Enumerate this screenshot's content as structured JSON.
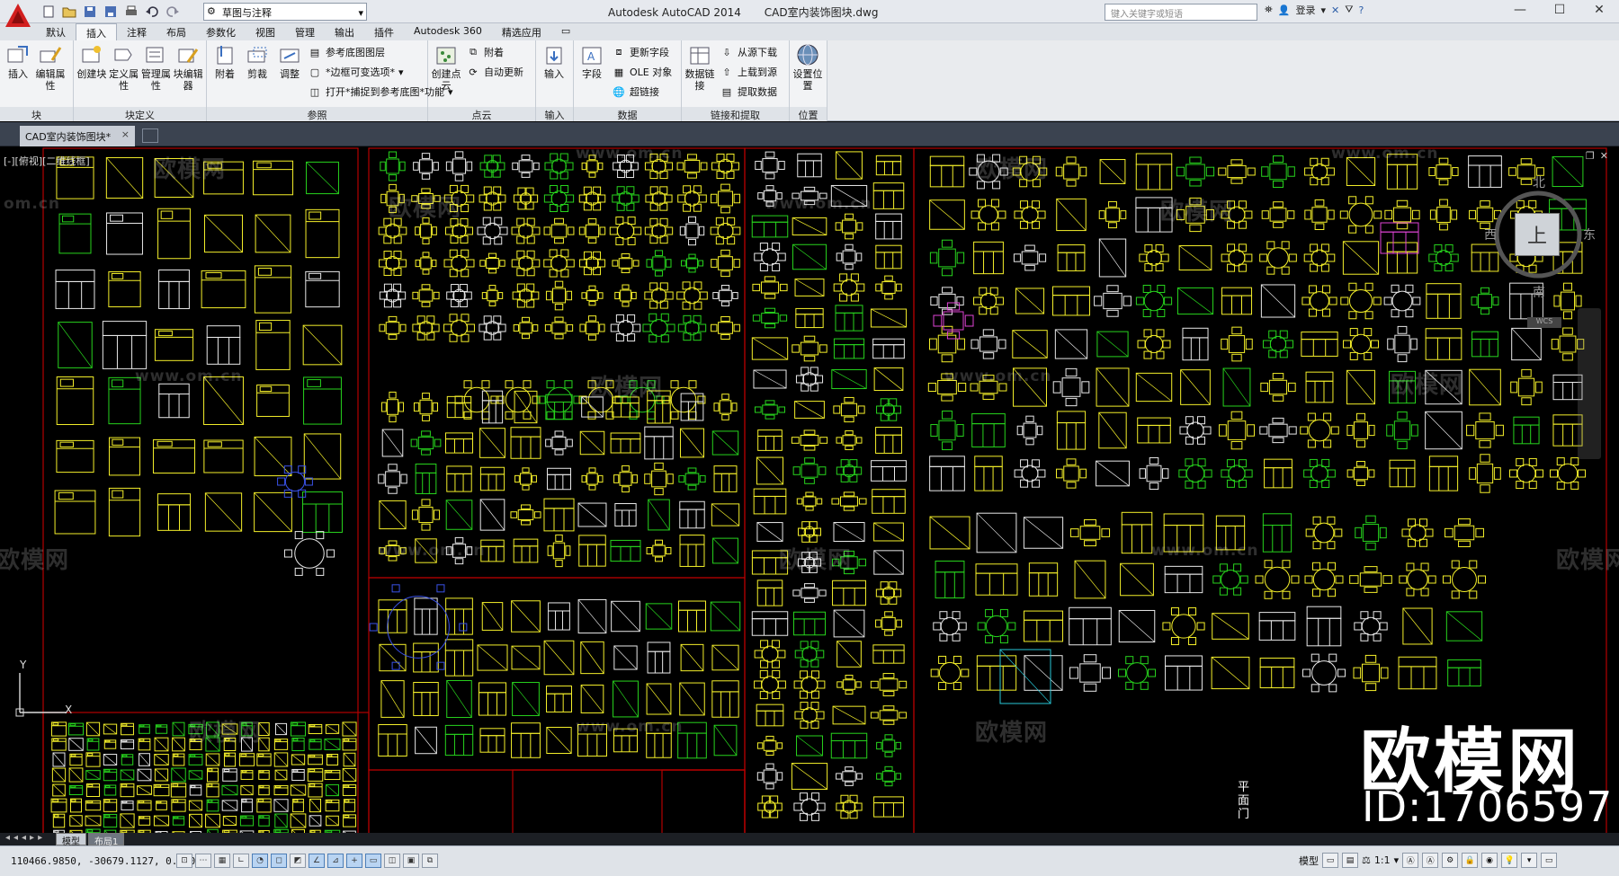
{
  "titlebar": {
    "workspace": "草图与注释",
    "app_name": "Autodesk AutoCAD 2014",
    "file_name": "CAD室内装饰图块.dwg",
    "search_placeholder": "键入关键字或短语",
    "login_label": "登录"
  },
  "ribbon_tabs": [
    "默认",
    "插入",
    "注释",
    "布局",
    "参数化",
    "视图",
    "管理",
    "输出",
    "插件",
    "Autodesk 360",
    "精选应用"
  ],
  "active_tab": "插入",
  "panels": {
    "block": {
      "title": "块",
      "buttons": [
        "插入",
        "编辑属性"
      ]
    },
    "block_def": {
      "title": "块定义",
      "buttons": [
        "创建块",
        "定义属性",
        "管理属性",
        "块编辑器"
      ]
    },
    "reference": {
      "title": "参照",
      "buttons": [
        "附着",
        "剪裁",
        "调整"
      ],
      "small": [
        "参考底图图层",
        "*边框可变选项*",
        "打开*捕捉到参考底图*功能"
      ]
    },
    "pointcloud": {
      "title": "点云",
      "button": "创建点云",
      "small": [
        "附着",
        "自动更新"
      ]
    },
    "import": {
      "title": "输入",
      "button": "输入"
    },
    "data": {
      "title": "数据",
      "button": "字段",
      "small": [
        "更新字段",
        "OLE 对象",
        "超链接"
      ]
    },
    "link": {
      "title": "链接和提取",
      "button": "数据链接",
      "small": [
        "从源下载",
        "上载到源",
        "提取数据"
      ]
    },
    "location": {
      "title": "位置",
      "button": "设置位置"
    }
  },
  "doc_tab": "CAD室内装饰图块*",
  "viewport_label": "[-][俯视][二维线框]",
  "viewcube": {
    "top": "上",
    "north": "北",
    "south": "南",
    "east": "东",
    "west": "西",
    "wcs": "WCS"
  },
  "watermarks": {
    "brand": "欧模网",
    "url": "www.om.cn",
    "id": "ID:1706597",
    "url_short": "om.cn",
    "brand_partial": "欧模网"
  },
  "side_label": [
    "平",
    "面",
    "门"
  ],
  "ucs": {
    "x": "X",
    "y": "Y"
  },
  "layout_tabs": [
    "模型",
    "布局1"
  ],
  "status": {
    "coords": "110466.9850, -30679.1127, 0.0000",
    "space": "模型",
    "scale": "1:1"
  },
  "colors": {
    "frame_red": "#b40000",
    "block_yellow": "#f4ef2a",
    "block_green": "#27d31d",
    "block_white": "#e8e8e8",
    "block_magenta": "#e044d6",
    "block_blue": "#3a52e8",
    "block_cyan": "#28c8d8"
  }
}
